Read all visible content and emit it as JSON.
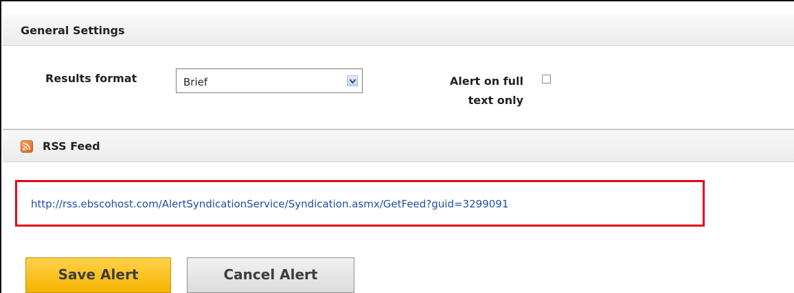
{
  "general_settings": {
    "title": "General Settings",
    "results_format_label": "Results format",
    "results_format_value": "Brief",
    "alert_full_text_label_line1": "Alert on full",
    "alert_full_text_label_line2": "text only",
    "alert_full_text_checked": false
  },
  "rss": {
    "title": "RSS Feed",
    "icon": "rss-icon",
    "feed_url": "http://rss.ebscohost.com/AlertSyndicationService/Syndication.asmx/GetFeed?guid=3299091",
    "highlight_color": "#e3001b"
  },
  "buttons": {
    "save_label": "Save Alert",
    "cancel_label": "Cancel Alert",
    "save_color": "#f5b400"
  }
}
